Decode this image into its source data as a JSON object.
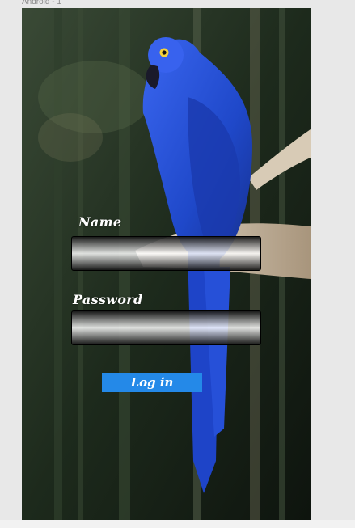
{
  "artboard": {
    "label": "Android - 1"
  },
  "login_form": {
    "name_label": "Name",
    "name_value": "",
    "password_label": "Password",
    "password_value": "",
    "login_button_label": "Log in"
  },
  "colors": {
    "button": "#2489e8",
    "parrot": "#2a54d6",
    "background_forest": "#1b2a1b"
  },
  "background_image": {
    "subject": "parrot-photo"
  }
}
